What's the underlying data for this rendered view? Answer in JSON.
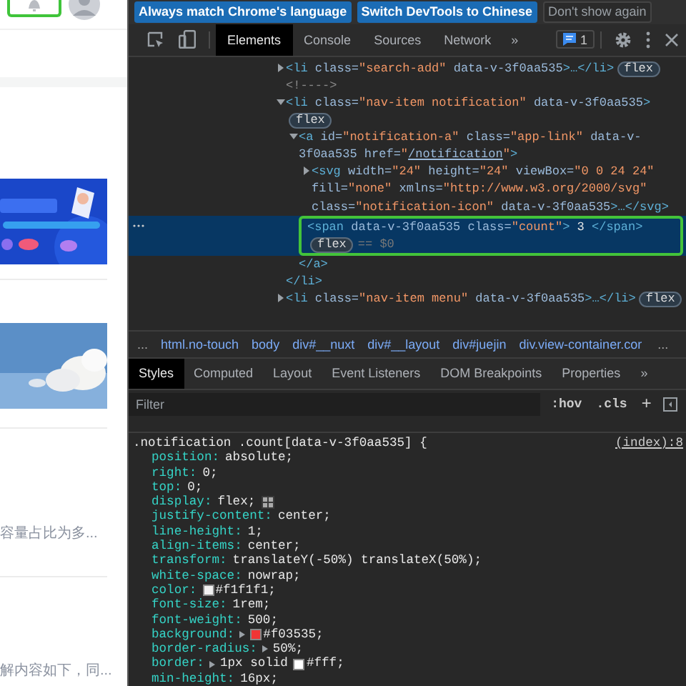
{
  "page": {
    "snippets": [
      "容量占比为多...",
      "解内容如下，同..."
    ]
  },
  "devtools": {
    "infobar": [
      {
        "label": "Always match Chrome's language",
        "kind": "primary"
      },
      {
        "label": "Switch DevTools to Chinese",
        "kind": "primary"
      },
      {
        "label": "Don't show again",
        "kind": "plain"
      }
    ],
    "tabs": [
      {
        "label": "Elements",
        "selected": true
      },
      {
        "label": "Console",
        "selected": false
      },
      {
        "label": "Sources",
        "selected": false
      },
      {
        "label": "Network",
        "selected": false
      }
    ],
    "tabs_overflow": "»",
    "issues_count": "1",
    "dom_tree": [
      {
        "kind": "collapsed",
        "selected": false,
        "badge": "flex",
        "parts": [
          {
            "kind": "tag",
            "s": "<li"
          },
          {
            "kind": "attr",
            "s": " class="
          },
          {
            "kind": "val",
            "s": "\"search-add\""
          },
          {
            "kind": "attr",
            "s": " data-v-3f0aa535"
          },
          {
            "kind": "tag",
            "s": ">…</li>"
          }
        ]
      },
      {
        "kind": "leaf",
        "selected": false,
        "parts": [
          {
            "kind": "comment",
            "s": "<!---->"
          }
        ]
      },
      {
        "kind": "expanded",
        "selected": false,
        "badge": "flex",
        "closing": "</li>",
        "parts": [
          {
            "kind": "tag",
            "s": "<li"
          },
          {
            "kind": "attr",
            "s": " class="
          },
          {
            "kind": "val",
            "s": "\"nav-item notification\""
          },
          {
            "kind": "attr",
            "s": " data-v-3f0aa535"
          },
          {
            "kind": "tag",
            "s": ">"
          }
        ],
        "children": [
          {
            "kind": "expanded",
            "selected": false,
            "closing": "</a>",
            "parts": [
              {
                "kind": "tag",
                "s": "<a"
              },
              {
                "kind": "attr",
                "s": " id="
              },
              {
                "kind": "val",
                "s": "\"notification-a\""
              },
              {
                "kind": "attr",
                "s": " class="
              },
              {
                "kind": "val",
                "s": "\"app-link\""
              },
              {
                "kind": "attr",
                "s": " data-v-3f0aa535"
              },
              {
                "kind": "attr",
                "s": " href="
              },
              {
                "kind": "val",
                "s": "\""
              },
              {
                "kind": "link",
                "s": "/notification"
              },
              {
                "kind": "val",
                "s": "\""
              },
              {
                "kind": "tag",
                "s": ">"
              }
            ],
            "children": [
              {
                "kind": "collapsed",
                "selected": false,
                "parts": [
                  {
                    "kind": "tag",
                    "s": "<svg"
                  },
                  {
                    "kind": "attr",
                    "s": " width="
                  },
                  {
                    "kind": "val",
                    "s": "\"24\""
                  },
                  {
                    "kind": "attr",
                    "s": " height="
                  },
                  {
                    "kind": "val",
                    "s": "\"24\""
                  },
                  {
                    "kind": "attr",
                    "s": " viewBox="
                  },
                  {
                    "kind": "val",
                    "s": "\"0 0 24 24\""
                  },
                  {
                    "kind": "attr",
                    "s": " fill="
                  },
                  {
                    "kind": "val",
                    "s": "\"none\""
                  },
                  {
                    "kind": "attr",
                    "s": " xmlns="
                  },
                  {
                    "kind": "val",
                    "s": "\"http://www.w3.org/2000/svg\""
                  },
                  {
                    "kind": "attr",
                    "s": " class="
                  },
                  {
                    "kind": "val",
                    "s": "\"notification-icon\""
                  },
                  {
                    "kind": "attr",
                    "s": " data-v-3f0aa535"
                  },
                  {
                    "kind": "tag",
                    "s": ">…</svg>"
                  }
                ]
              },
              {
                "kind": "leaf",
                "selected": true,
                "badge": "flex",
                "marker": "== $0",
                "parts": [
                  {
                    "kind": "tag",
                    "s": "<span"
                  },
                  {
                    "kind": "attr",
                    "s": " data-v-3f0aa535"
                  },
                  {
                    "kind": "attr",
                    "s": " class="
                  },
                  {
                    "kind": "val",
                    "s": "\"count\""
                  },
                  {
                    "kind": "tag",
                    "s": ">"
                  },
                  {
                    "kind": "text",
                    "s": " 3 "
                  },
                  {
                    "kind": "tag",
                    "s": "</span>"
                  }
                ]
              }
            ]
          }
        ]
      },
      {
        "kind": "collapsed",
        "selected": false,
        "badge": "flex",
        "parts": [
          {
            "kind": "tag",
            "s": "<li"
          },
          {
            "kind": "attr",
            "s": " class="
          },
          {
            "kind": "val",
            "s": "\"nav-item menu\""
          },
          {
            "kind": "attr",
            "s": " data-v-3f0aa535"
          },
          {
            "kind": "tag",
            "s": ">…</li>"
          }
        ]
      }
    ],
    "breadcrumb_lead": "...",
    "breadcrumbs": [
      "html.no-touch",
      "body",
      "div#__nuxt",
      "div#__layout",
      "div#juejin",
      "div.view-container.cor"
    ],
    "breadcrumb_trail": "...",
    "styles_tabs": [
      {
        "label": "Styles",
        "selected": true
      },
      {
        "label": "Computed",
        "selected": false
      },
      {
        "label": "Layout",
        "selected": false
      },
      {
        "label": "Event Listeners",
        "selected": false
      },
      {
        "label": "DOM Breakpoints",
        "selected": false
      },
      {
        "label": "Properties",
        "selected": false
      }
    ],
    "styles_overflow": "»",
    "filter": {
      "placeholder": "Filter",
      "hov": ":hov",
      "cls": ".cls",
      "add": "+"
    },
    "rule": {
      "selector": ".notification .count[data-v-3f0aa535] {",
      "source": "(index):8",
      "declarations": [
        {
          "name": "position:",
          "value": "absolute;",
          "expandable": false,
          "grid_editor": false
        },
        {
          "name": "right:",
          "value": "0;",
          "expandable": false,
          "grid_editor": false
        },
        {
          "name": "top:",
          "value": "0;",
          "expandable": false,
          "grid_editor": false
        },
        {
          "name": "display:",
          "value": "flex;",
          "expandable": false,
          "grid_editor": true
        },
        {
          "name": "justify-content:",
          "value": "center;",
          "expandable": false,
          "grid_editor": false
        },
        {
          "name": "line-height:",
          "value": "1;",
          "expandable": false,
          "grid_editor": false
        },
        {
          "name": "align-items:",
          "value": "center;",
          "expandable": false,
          "grid_editor": false
        },
        {
          "name": "transform:",
          "value": "translateY(-50%) translateX(50%);",
          "expandable": false,
          "grid_editor": false
        },
        {
          "name": "white-space:",
          "value": "nowrap;",
          "expandable": false,
          "grid_editor": false
        },
        {
          "name": "color:",
          "color": "#f1f1f1",
          "value": "#f1f1f1;",
          "expandable": false,
          "grid_editor": false
        },
        {
          "name": "font-size:",
          "value": "1rem;",
          "expandable": false,
          "grid_editor": false
        },
        {
          "name": "font-weight:",
          "value": "500;",
          "expandable": false,
          "grid_editor": false
        },
        {
          "name": "background:",
          "color": "#f03535",
          "value": "#f03535;",
          "expandable": true,
          "grid_editor": false
        },
        {
          "name": "border-radius:",
          "value": "50%;",
          "expandable": true,
          "grid_editor": false
        },
        {
          "name": "border:",
          "before": "1px solid",
          "color": "#ffffff",
          "value": "#fff;",
          "expandable": true,
          "grid_editor": false
        },
        {
          "name": "min-height:",
          "value": "16px;",
          "expandable": false,
          "grid_editor": false
        }
      ]
    }
  }
}
